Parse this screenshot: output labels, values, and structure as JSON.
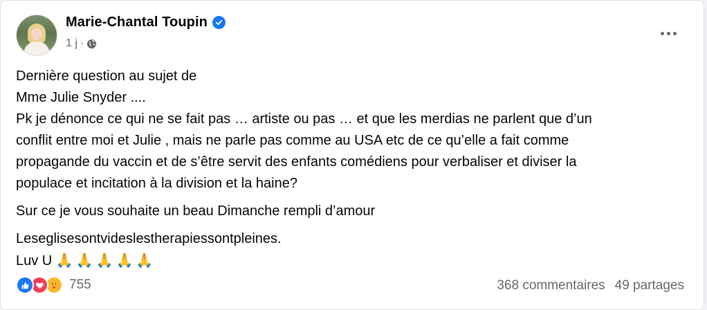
{
  "post": {
    "author": "Marie-Chantal Toupin",
    "time": "1 j",
    "separator": "·",
    "privacy_icon": "globe-icon",
    "verified_icon": "verified-badge-icon",
    "menu_icon": "more-options-icon",
    "text": {
      "line1": "Dernière question au sujet de",
      "line2": "Mme Julie Snyder ....",
      "line3": "Pk je dénonce ce qui ne se fait pas … artiste ou pas … et que les merdias ne parlent que d’un",
      "line4": "conflit entre moi et Julie , mais ne parle pas comme au USA etc de ce qu’elle a fait comme",
      "line5": "propagande du vaccin et de s’être servit des enfants comédiens pour verbaliser et diviser la",
      "line6": "populace et incitation à la division et la haine?",
      "para2": "Sur ce je vous souhaite un beau Dimanche rempli d’amour",
      "para3_line1": "Leseglisesontvideslestherapiessontpleines.",
      "para3_line2": "Luv U",
      "emojis": "🙏🙏🙏🙏🙏"
    }
  },
  "footer": {
    "reaction_icons": [
      "like-icon",
      "love-icon",
      "care-icon"
    ],
    "reaction_count": "755",
    "comments": "368 commentaires",
    "shares": "49 partages"
  },
  "colors": {
    "primary_text": "#050505",
    "secondary_text": "#65676b",
    "brand_blue": "#1877f2",
    "love_red": "#f33e58",
    "care_yellow": "#f7b928"
  }
}
